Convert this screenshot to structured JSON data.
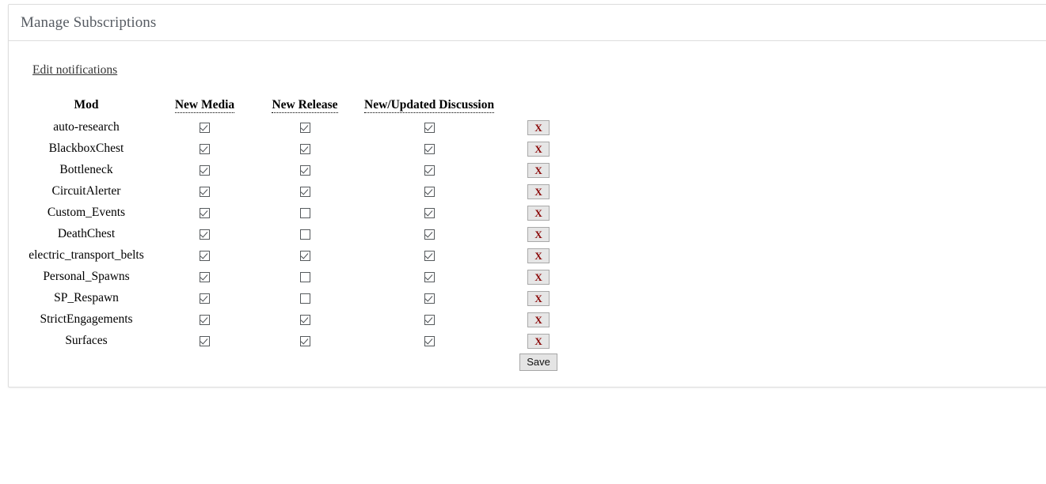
{
  "panel": {
    "title": "Manage Subscriptions"
  },
  "links": {
    "edit_notifications": "Edit notifications"
  },
  "table": {
    "headers": {
      "mod": "Mod",
      "new_media": "New Media",
      "new_release": "New Release",
      "new_updated_discussion": "New/Updated Discussion",
      "delete": ""
    },
    "delete_button_label": "X",
    "rows": [
      {
        "mod": "auto-research",
        "new_media": true,
        "new_release": true,
        "new_discussion": true
      },
      {
        "mod": "BlackboxChest",
        "new_media": true,
        "new_release": true,
        "new_discussion": true
      },
      {
        "mod": "Bottleneck",
        "new_media": true,
        "new_release": true,
        "new_discussion": true
      },
      {
        "mod": "CircuitAlerter",
        "new_media": true,
        "new_release": true,
        "new_discussion": true
      },
      {
        "mod": "Custom_Events",
        "new_media": true,
        "new_release": false,
        "new_discussion": true
      },
      {
        "mod": "DeathChest",
        "new_media": true,
        "new_release": false,
        "new_discussion": true
      },
      {
        "mod": "electric_transport_belts",
        "new_media": true,
        "new_release": true,
        "new_discussion": true
      },
      {
        "mod": "Personal_Spawns",
        "new_media": true,
        "new_release": false,
        "new_discussion": true
      },
      {
        "mod": "SP_Respawn",
        "new_media": true,
        "new_release": false,
        "new_discussion": true
      },
      {
        "mod": "StrictEngagements",
        "new_media": true,
        "new_release": true,
        "new_discussion": true
      },
      {
        "mod": "Surfaces",
        "new_media": true,
        "new_release": true,
        "new_discussion": true
      }
    ]
  },
  "actions": {
    "save_label": "Save"
  },
  "colors": {
    "title_text": "#575c63",
    "panel_border": "#dddddd",
    "delete_x": "#8b0a0a",
    "button_face": "#e6e6e6",
    "button_border": "#a9a9a9",
    "checkbox_border": "#55595c"
  }
}
